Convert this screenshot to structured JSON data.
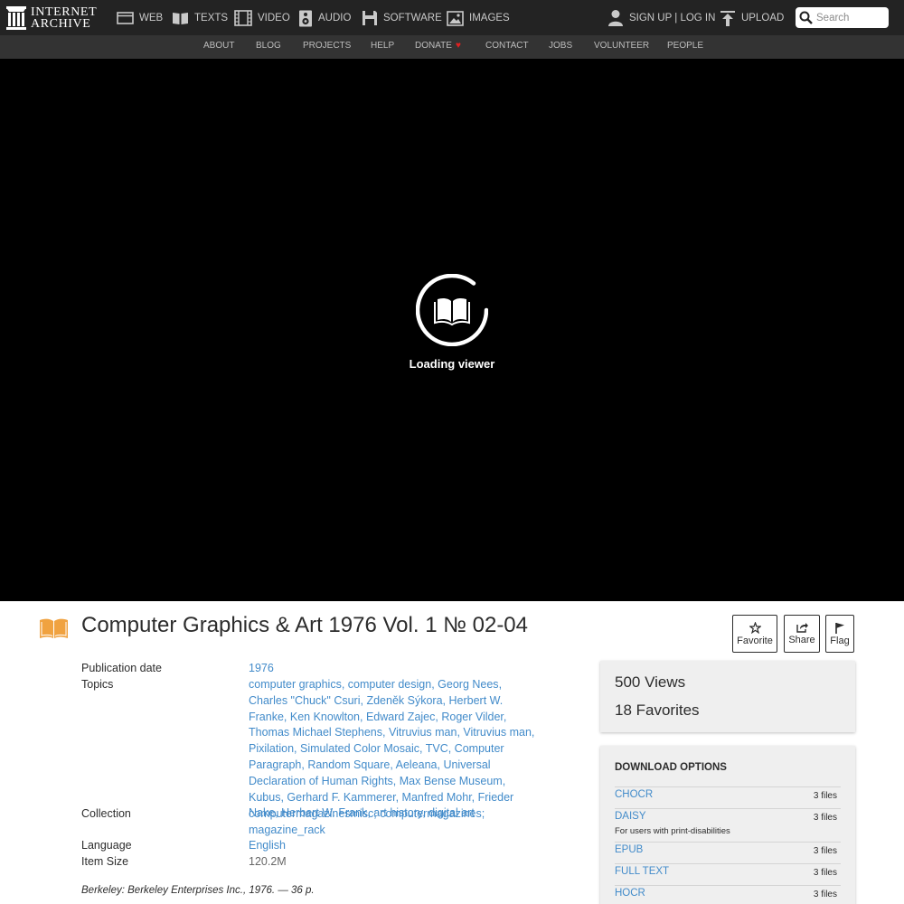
{
  "header": {
    "logo": {
      "line1": "INTERNET",
      "line2": "ARCHIVE"
    },
    "nav": [
      {
        "label": "WEB",
        "icon": "web-icon"
      },
      {
        "label": "TEXTS",
        "icon": "texts-icon"
      },
      {
        "label": "VIDEO",
        "icon": "video-icon"
      },
      {
        "label": "AUDIO",
        "icon": "audio-icon"
      },
      {
        "label": "SOFTWARE",
        "icon": "software-icon"
      },
      {
        "label": "IMAGES",
        "icon": "images-icon"
      }
    ],
    "signin_label": "SIGN UP | LOG IN",
    "upload_label": "UPLOAD",
    "search_placeholder": "Search"
  },
  "subnav": {
    "items": [
      "ABOUT",
      "BLOG",
      "PROJECTS",
      "HELP",
      "DONATE",
      "CONTACT",
      "JOBS",
      "VOLUNTEER",
      "PEOPLE"
    ]
  },
  "viewer": {
    "loading_text": "Loading viewer"
  },
  "item": {
    "title": "Computer Graphics & Art 1976 Vol. 1 № 02-04",
    "actions": [
      "Favorite",
      "Share",
      "Flag"
    ]
  },
  "metadata": {
    "labels": {
      "publication_date": "Publication date",
      "topics": "Topics",
      "collection": "Collection",
      "language": "Language",
      "item_size": "Item Size"
    },
    "publication_date": "1976",
    "topics": [
      "computer graphics",
      "computer design",
      "Georg Nees",
      "Charles \"Chuck\" Csuri",
      "Zdeněk Sýkora",
      "Herbert W. Franke",
      "Ken Knowlton",
      "Edward Zajec",
      "Roger Vilder",
      "Thomas Michael Stephens",
      "Vitruvius man",
      "Vitruvius man",
      "Pixilation",
      "Simulated Color Mosaic",
      "TVC",
      "Computer Paragraph",
      "Random Square",
      "Aeleana",
      "Universal Declaration of Human Rights",
      "Max Bense Museum",
      "Kubus",
      "Gerhard F. Kammerer",
      "Manfred Mohr",
      "Frieder Nake",
      "Herbert W. Frank",
      "art history",
      "digital art"
    ],
    "collections": [
      "computermagazinesmisc",
      "computermagazines",
      "magazine_rack"
    ],
    "language": "English",
    "item_size": "120.2M",
    "description": "Berkeley: Berkeley Enterprises Inc., 1976. — 36 p."
  },
  "stats": {
    "views": "500 Views",
    "favorites": "18 Favorites"
  },
  "downloads": {
    "heading": "DOWNLOAD OPTIONS",
    "rows": [
      {
        "format": "CHOCR",
        "count": "3 files",
        "note": ""
      },
      {
        "format": "DAISY",
        "count": "3 files",
        "note": "For users with print-disabilities"
      },
      {
        "format": "EPUB",
        "count": "3 files",
        "note": ""
      },
      {
        "format": "FULL TEXT",
        "count": "3 files",
        "note": ""
      },
      {
        "format": "HOCR",
        "count": "3 files",
        "note": ""
      }
    ]
  },
  "colors": {
    "topbar": "#232323",
    "subnav": "#333333",
    "link": "#428bca",
    "item_icon": "#f0a240",
    "heart": "#e02020"
  }
}
